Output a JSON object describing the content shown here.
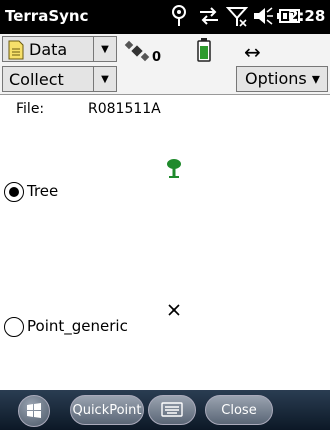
{
  "status_bar": {
    "app_title": "TerraSync",
    "time": "2:28",
    "icons": [
      "gps-icon",
      "sync-icon",
      "no-signal-icon",
      "volume-icon",
      "battery-icon"
    ]
  },
  "toolbar": {
    "section_dropdown": {
      "value": "Data",
      "icon": "document-icon"
    },
    "satellite_count": "0",
    "arrows_glyph": "↔"
  },
  "subbar": {
    "mode_dropdown": {
      "value": "Collect"
    },
    "options_label": "Options ▾"
  },
  "main": {
    "file_label": "File:",
    "file_name": "R081511A",
    "features": [
      {
        "label": "Tree",
        "selected": true,
        "icon": "tree-icon"
      },
      {
        "label": "Point_generic",
        "selected": false,
        "icon": "x-point-icon"
      }
    ]
  },
  "taskbar": {
    "quickpoint_label": "QuickPoint",
    "close_label": "Close"
  },
  "colors": {
    "title_bg": "#000000",
    "toolbar_bg": "#f3f3f3",
    "tree_green": "#1f8a2c",
    "taskbar_top": "#2a3d52"
  }
}
